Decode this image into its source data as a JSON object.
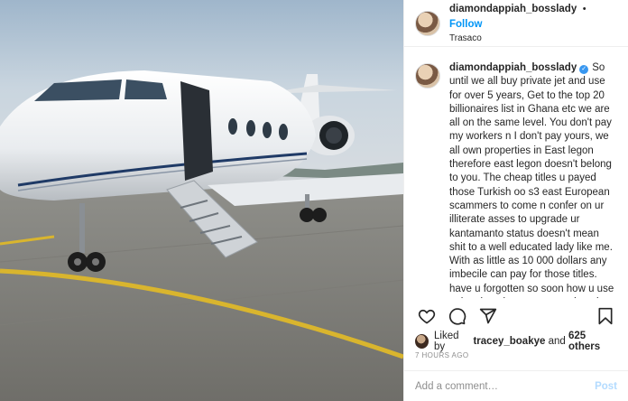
{
  "post": {
    "username": "diamondappiah_bosslady",
    "follow_label": "Follow",
    "separator": "•",
    "location": "Trasaco",
    "verified_mark": "✓",
    "caption": "So until we all buy private jet and use for over 5 years, Get to the top 20 billionaires list in Ghana etc we are all on the same level. You don't pay my workers n I don't pay yours, we all own properties in East legon therefore east legon doesn't belong to you. The cheap titles u payed those Turkish oo s3 east European scammers to come n confer on ur illiterate asses to upgrade ur kantamanto status doesn't mean shit to a well educated lady like me. With as little as 10 000 dollars any imbecile can pay for those titles. have u forgotten so soon how u use to hustle at kantamanto n sleep in people's studios. Useless cheap men with no shame. The day I will erupt like a Tonardo n expose how u robbed",
    "liked_by_prefix": "Liked by",
    "liked_by_user": "tracey_boakye",
    "liked_by_joiner": "and",
    "likes_count": "625 others",
    "timestamp": "7 HOURS AGO",
    "comment_placeholder": "Add a comment…",
    "post_label": "Post"
  },
  "icons": {
    "like": "heart-icon",
    "comment": "comment-icon",
    "share": "share-icon",
    "save": "bookmark-icon"
  },
  "colors": {
    "link_blue": "#0095f6",
    "post_disabled": "#b3dbff",
    "muted": "#8e8e8e"
  }
}
